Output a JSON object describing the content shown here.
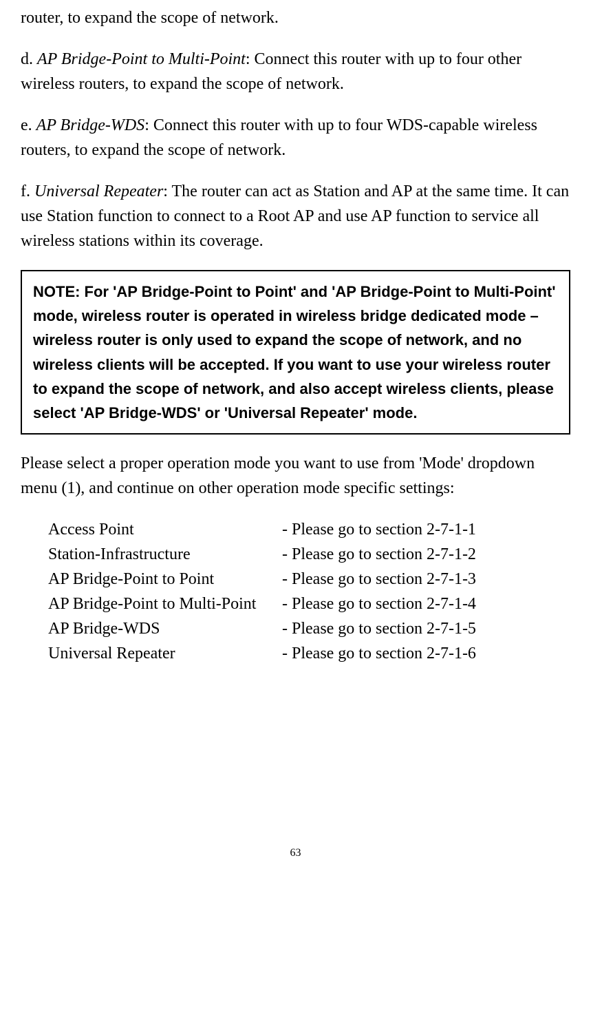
{
  "top_fragment": "router, to expand the scope of network.",
  "item_d": {
    "label": "d. ",
    "title": "AP Bridge-Point to Multi-Point",
    "desc": ": Connect this router with up to four other wireless routers, to expand the scope of network."
  },
  "item_e": {
    "label": "e. ",
    "title": "AP Bridge-WDS",
    "desc": ": Connect this router with up to four WDS-capable wireless routers, to expand the scope of network."
  },
  "item_f": {
    "label": "f. ",
    "title": "Universal Repeater",
    "desc": ": The router can act as Station and AP at the same time. It can use Station function to connect to a Root AP and use AP function to service all wireless stations within its coverage."
  },
  "note_text": "NOTE: For 'AP Bridge-Point to Point' and 'AP Bridge-Point to Multi-Point' mode, wireless router is operated in wireless bridge dedicated mode – wireless router is only used to expand the scope of network, and no wireless clients will be accepted. If you want to use your wireless router to expand the scope of network, and also accept wireless clients, please select 'AP Bridge-WDS' or 'Universal Repeater' mode.",
  "select_prompt": "Please select a proper operation mode you want to use from 'Mode' dropdown menu (1), and continue on other operation mode specific settings:",
  "modes": [
    {
      "name": "Access Point",
      "ref": "- Please go to section 2-7-1-1"
    },
    {
      "name": "Station-Infrastructure",
      "ref": "- Please go to section 2-7-1-2"
    },
    {
      "name": "AP Bridge-Point to Point",
      "ref": "- Please go to section 2-7-1-3"
    },
    {
      "name": "AP Bridge-Point to Multi-Point",
      "ref": "- Please go to section 2-7-1-4"
    },
    {
      "name": "AP Bridge-WDS",
      "ref": "- Please go to section 2-7-1-5"
    },
    {
      "name": "Universal Repeater",
      "ref": "- Please go to section 2-7-1-6"
    }
  ],
  "page_number": "63"
}
